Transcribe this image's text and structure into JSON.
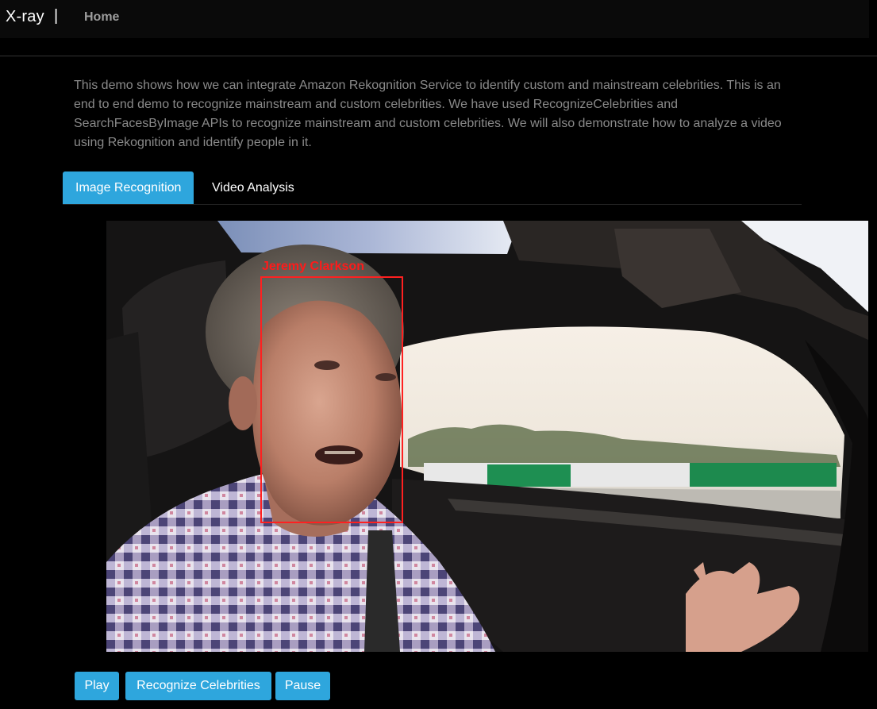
{
  "navbar": {
    "brand": "X-ray",
    "separator": "|",
    "home_label": "Home"
  },
  "intro": {
    "text": "This demo shows how we can integrate Amazon Rekognition Service to identify custom and mainstream celebrities. This is an end to end demo to recognize mainstream and custom celebrities. We have used RecognizeCelebrities and SearchFacesByImage APIs to recognize mainstream and custom celebrities. We will also demonstrate how to analyze a video using Rekognition and identify people in it."
  },
  "tabs": [
    {
      "label": "Image Recognition",
      "active": true
    },
    {
      "label": "Video Analysis",
      "active": false
    }
  ],
  "video": {
    "detected_face_label": "Jeremy Clarkson",
    "box_color": "#ff2020"
  },
  "controls": {
    "play_label": "Play",
    "recognize_label": "Recognize Celebrities",
    "pause_label": "Pause"
  },
  "colors": {
    "accent": "#2ea6dd",
    "background": "#000000",
    "intro_text": "#8a8a8a",
    "nav_link": "#9d9d9d"
  }
}
